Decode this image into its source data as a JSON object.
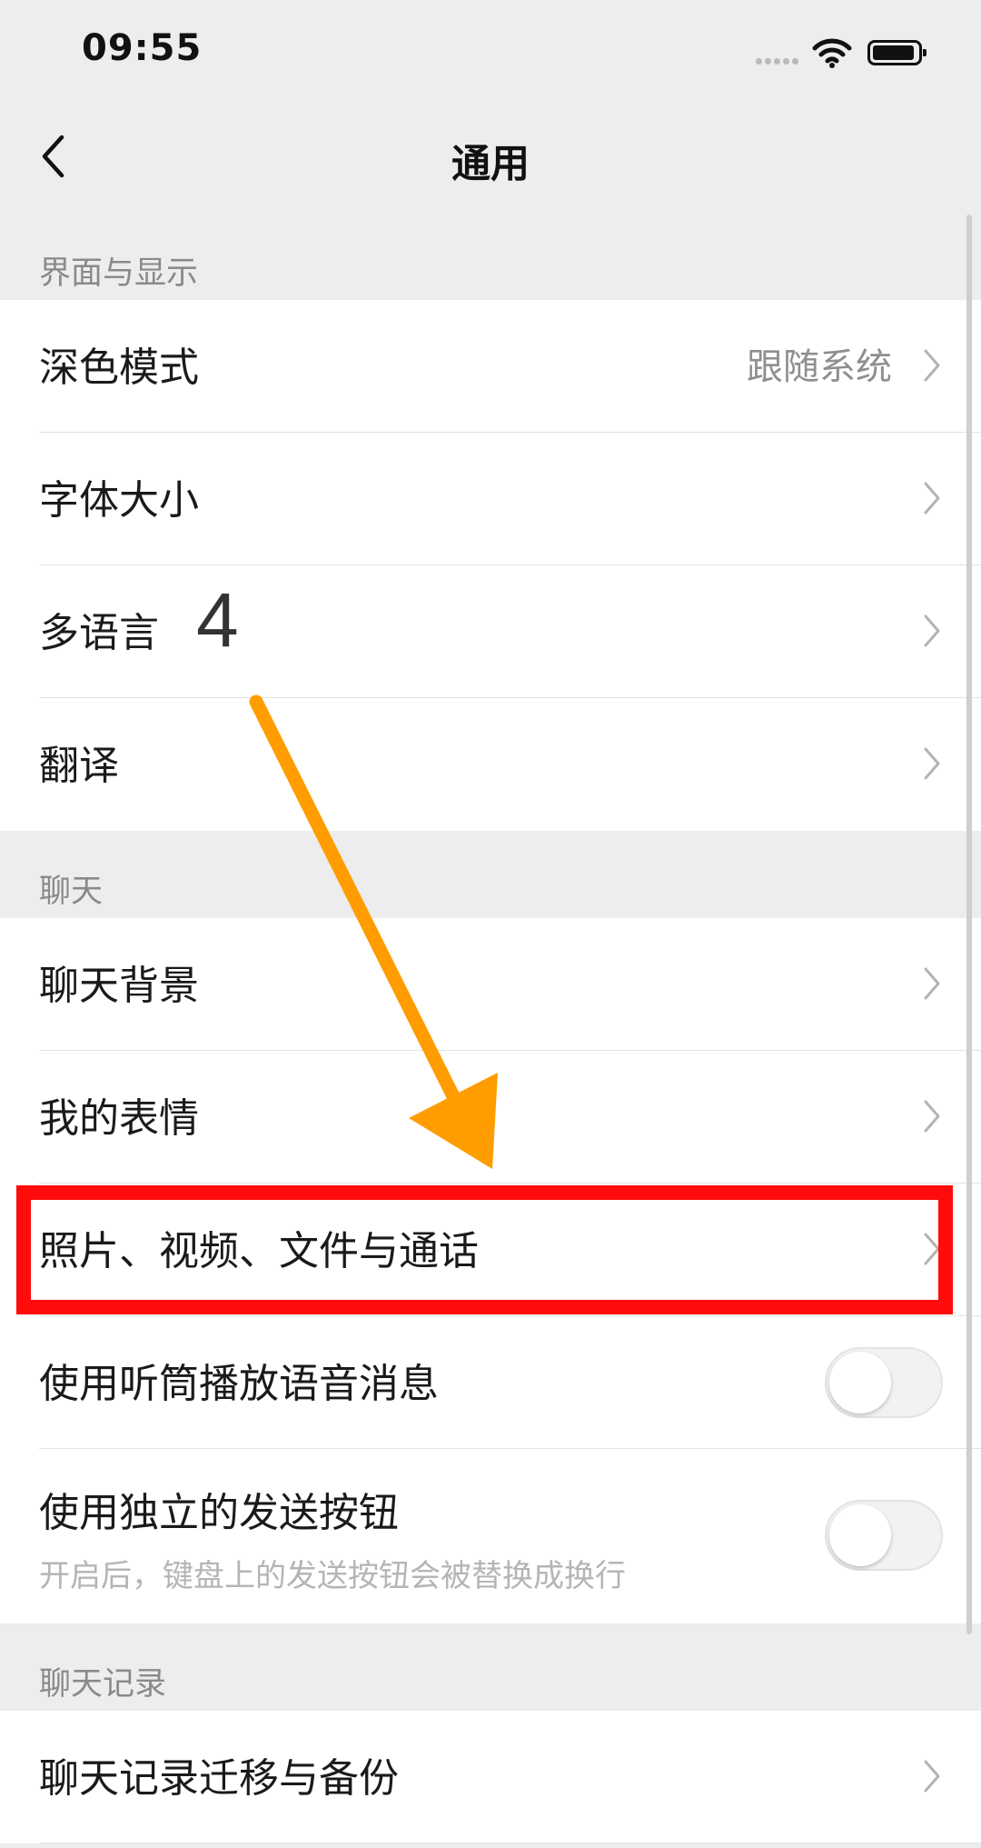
{
  "status_bar": {
    "time": "09:55"
  },
  "nav": {
    "title": "通用"
  },
  "sections": {
    "display": {
      "header": "界面与显示",
      "dark_mode": {
        "label": "深色模式",
        "value": "跟随系统"
      },
      "font_size": {
        "label": "字体大小"
      },
      "language": {
        "label": "多语言"
      },
      "translate": {
        "label": "翻译"
      }
    },
    "chat": {
      "header": "聊天",
      "background": {
        "label": "聊天背景"
      },
      "stickers": {
        "label": "我的表情"
      },
      "media": {
        "label": "照片、视频、文件与通话"
      },
      "earpiece": {
        "label": "使用听筒播放语音消息",
        "enabled": false
      },
      "send_button": {
        "label": "使用独立的发送按钮",
        "sublabel": "开启后，键盘上的发送按钮会被替换成换行",
        "enabled": false
      }
    },
    "history": {
      "header": "聊天记录",
      "migrate": {
        "label": "聊天记录迁移与备份"
      }
    }
  },
  "annotation": {
    "step_number": "4",
    "arrow_color": "#ff9d00",
    "highlight_color": "#ff0b0b"
  }
}
